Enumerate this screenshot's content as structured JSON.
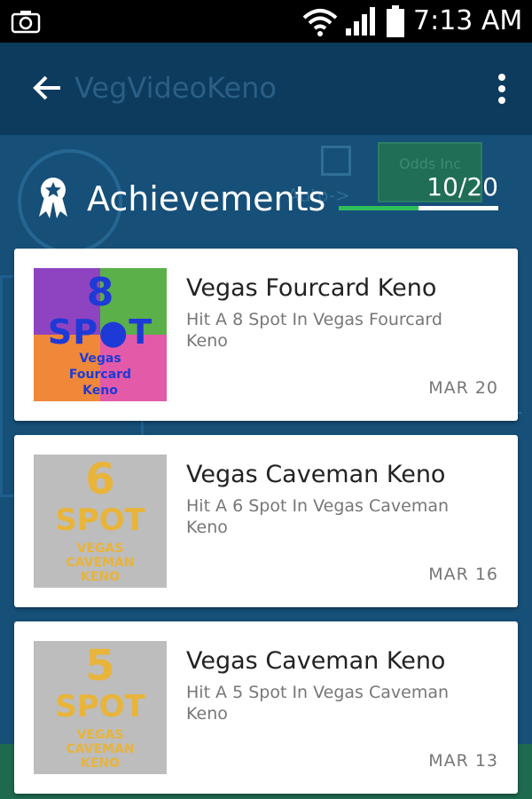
{
  "status_bar": {
    "time": "7:13 AM"
  },
  "background_app": {
    "title": "VegVideoKeno",
    "odds_label": "Odds Inc",
    "auto_label": "Auto->"
  },
  "achievements": {
    "title": "Achievements",
    "count": "10/20",
    "progress_fraction": 0.5,
    "items": [
      {
        "name": "Vegas Fourcard Keno",
        "description": "Hit A 8 Spot In Vegas Fourcard Keno",
        "date": "MAR 20",
        "badge": {
          "number": "8",
          "spot": "SP●T",
          "line1": "Vegas",
          "line2": "Fourcard",
          "line3": "Keno"
        }
      },
      {
        "name": "Vegas Caveman Keno",
        "description": "Hit A 6 Spot In Vegas Caveman Keno",
        "date": "MAR 16",
        "badge": {
          "number": "6",
          "spot": "SPOT",
          "line1": "VEGAS",
          "line2": "CAVEMAN",
          "line3": "KENO"
        }
      },
      {
        "name": "Vegas Caveman Keno",
        "description": "Hit A 5 Spot In Vegas Caveman Keno",
        "date": "MAR 13",
        "badge": {
          "number": "5",
          "spot": "SPOT",
          "line1": "VEGAS",
          "line2": "CAVEMAN",
          "line3": "KENO"
        }
      }
    ]
  },
  "colors": {
    "progress_fill": "#2fbf5a",
    "card_bg": "#ffffff",
    "overlay_bg": "#164f78"
  }
}
